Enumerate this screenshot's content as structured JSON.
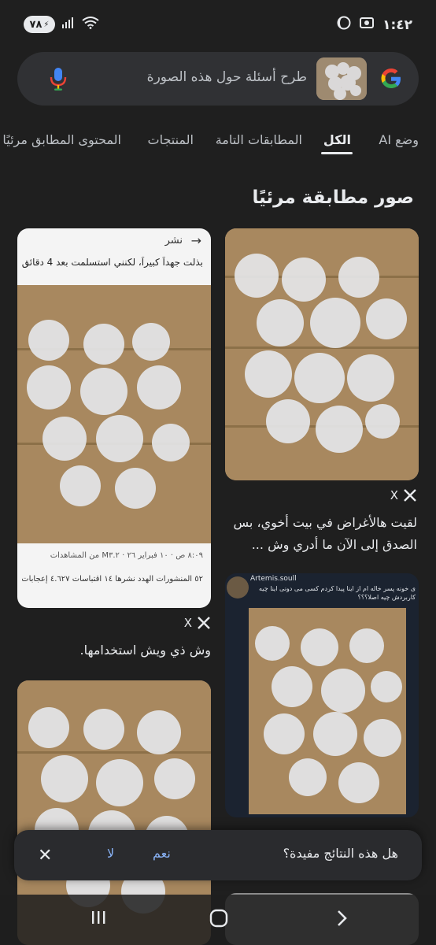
{
  "status_bar": {
    "battery": "٧٨",
    "time": "١:٤٢",
    "icons": [
      "battery-icon",
      "signal-icon",
      "wifi-icon",
      "moon-icon",
      "screenshot-icon"
    ]
  },
  "search": {
    "placeholder": "طرح أسئلة حول هذه الصورة",
    "icons": [
      "google-logo",
      "image-thumbnail",
      "mic-icon"
    ]
  },
  "tabs": [
    {
      "label": "وضع AI"
    },
    {
      "label": "الكل",
      "active": true
    },
    {
      "label": "المطابقات التامة"
    },
    {
      "label": "المنتجات"
    },
    {
      "label": "المحتوى المطابق مرئيًا"
    }
  ],
  "section_title": "صور مطابقة مرئيًا",
  "results": {
    "right_1": {
      "source": "X",
      "caption": "لقيت هالأغراض في بيت أخوي، بس الصدق إلى الآن ما أدري وش ..."
    },
    "left_1": {
      "post_header": "نشر",
      "post_text": "بذلت جهداً كبيراً، لكنني استسلمت بعد 4 دقائق",
      "post_meta": "٨:٠٩ ص · ١٠ فبراير ٢٦ · M٣.٢ من المشاهدات",
      "post_stats": "٥٢ المنشورات الهدد نشرها  ١٤ اقتباسات  ٤.٦٢٧ إعجابات",
      "source": "X",
      "caption": "وش ذي ويش استخدامها."
    },
    "right_2": {
      "user": "Artemis.soull",
      "post_text": "ی خونه پسر خاله ام از اینا پیدا کردم کسی می دونی اینا چیه کاربردش چیه اصلا؟؟؟"
    }
  },
  "feedback": {
    "question": "هل هذه النتائج مفيدة؟",
    "yes": "نعم",
    "no": "لا"
  },
  "nav": [
    "recents-icon",
    "home-icon",
    "back-icon"
  ]
}
